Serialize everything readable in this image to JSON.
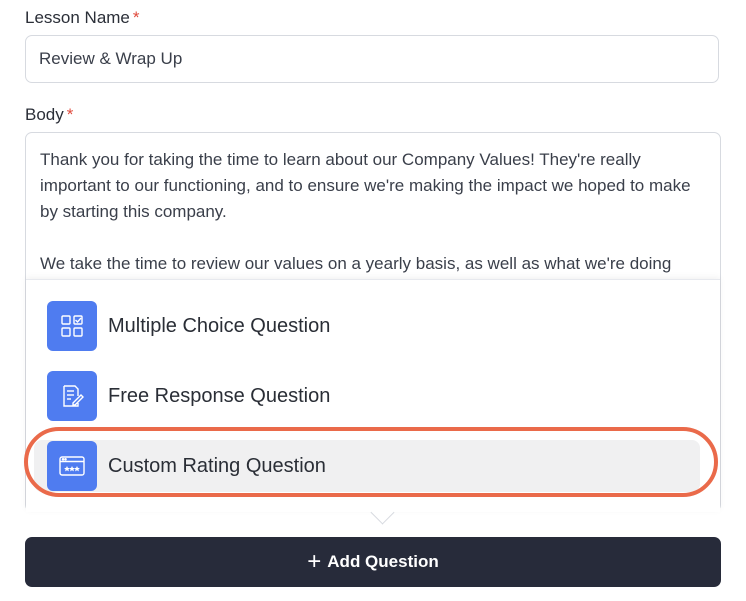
{
  "lesson_name": {
    "label": "Lesson Name",
    "required_marker": "*",
    "value": "Review & Wrap Up"
  },
  "body": {
    "label": "Body",
    "required_marker": "*",
    "paragraphs": [
      "Thank you for taking the time to learn about our Company Values! They're really important to our functioning, and to ensure we're making the impact we hoped to make by starting this company.",
      "We take the time to review our values on a yearly basis, as well as what we're doing"
    ]
  },
  "question_menu": {
    "items": [
      {
        "label": "Multiple Choice Question",
        "icon": "multiple-choice-icon"
      },
      {
        "label": "Free Response Question",
        "icon": "free-response-icon"
      },
      {
        "label": "Custom Rating Question",
        "icon": "rating-icon",
        "highlighted": true
      }
    ]
  },
  "add_question_button": {
    "label": "Add Question",
    "icon": "plus-icon"
  },
  "colors": {
    "accent": "#4f7cf0",
    "button_bg": "#272b3a",
    "required": "#e04a3c",
    "annotation": "#ea6a4a"
  }
}
